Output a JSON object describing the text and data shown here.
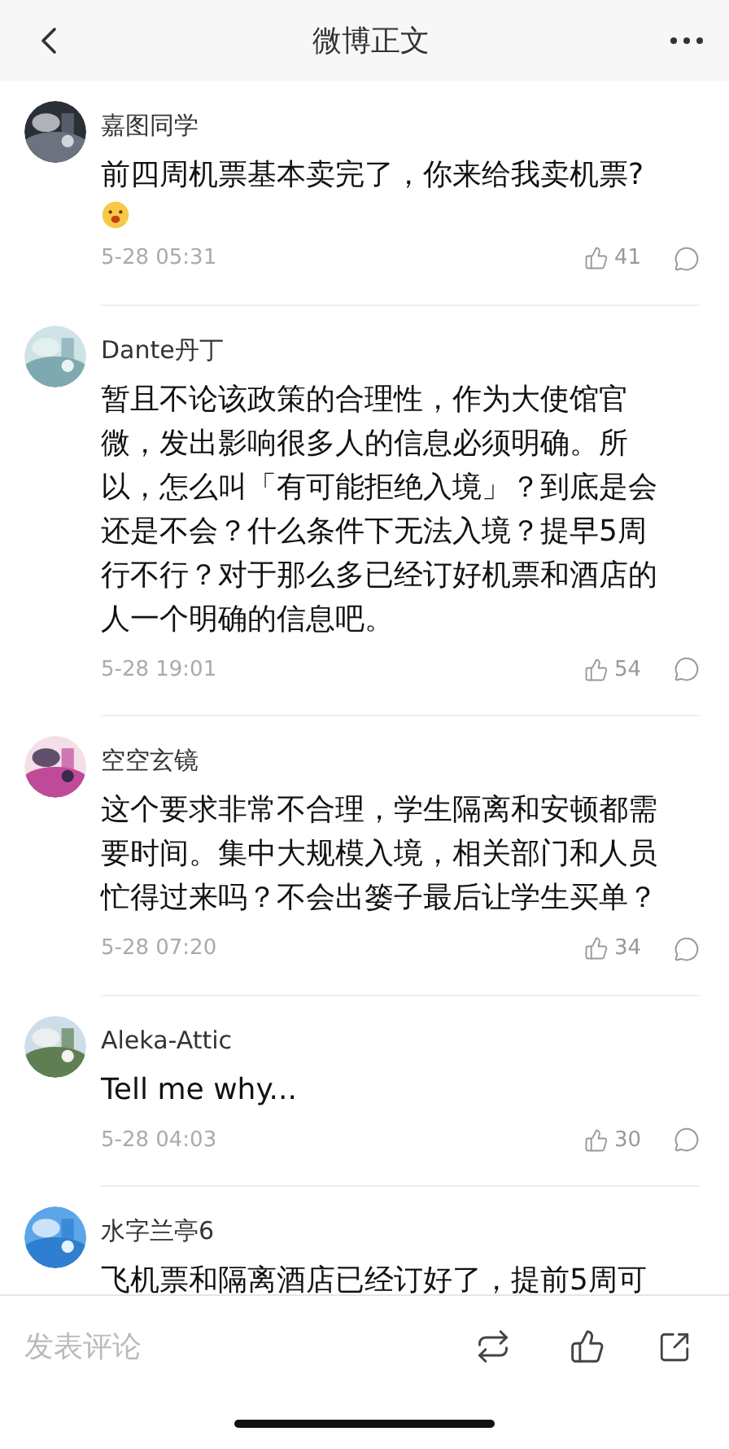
{
  "header": {
    "title": "微博正文"
  },
  "comments": [
    {
      "user": "嘉图同学",
      "text": "前四周机票基本卖完了，你来给我卖机票?",
      "emoji": true,
      "time": "5-28 05:31",
      "likes": "41"
    },
    {
      "user": "Dante丹丁",
      "text": "暂且不论该政策的合理性，作为大使馆官微，发出影响很多人的信息必须明确。所以，怎么叫「有可能拒绝入境」？到底是会还是不会？什么条件下无法入境？提早5周行不行？对于那么多已经订好机票和酒店的人一个明确的信息吧。",
      "emoji": false,
      "time": "5-28 19:01",
      "likes": "54"
    },
    {
      "user": "空空玄镜",
      "text": "这个要求非常不合理，学生隔离和安顿都需要时间。集中大规模入境，相关部门和人员忙得过来吗？不会出篓子最后让学生买单？",
      "emoji": false,
      "time": "5-28 07:20",
      "likes": "34"
    },
    {
      "user": "Aleka-Attic",
      "text": "Tell me why...",
      "emoji": false,
      "time": "5-28 04:03",
      "likes": "30"
    },
    {
      "user": "水字兰亭6",
      "text": "飞机票和隔离酒店已经订好了，提前5周可",
      "emoji": false
    }
  ],
  "footer": {
    "placeholder": "发表评论"
  }
}
